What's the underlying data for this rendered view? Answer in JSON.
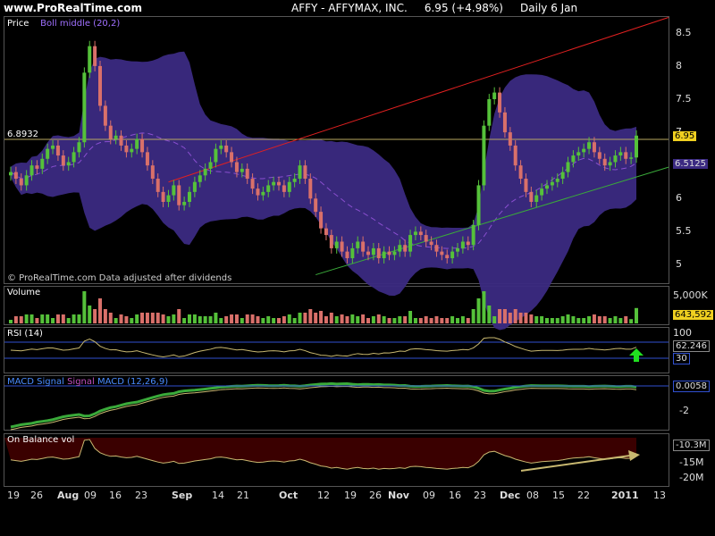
{
  "header": {
    "site": "www.ProRealTime.com",
    "ticker": "AFFY - AFFYMAX, INC.",
    "quote": "6.95 (+4.98%)",
    "period": "Daily  6 Jan"
  },
  "price_panel": {
    "label": "Price",
    "indicator": "Boll middle (20,2)",
    "watermark": "© ProRealTime.com  Data adjusted after dividends",
    "left_level": "6.8932",
    "last_price": "6.95",
    "boll_value": "6.5125",
    "ticks": [
      "8.5",
      "8",
      "7.5",
      "7",
      "6.5",
      "6",
      "5.5",
      "5"
    ]
  },
  "volume_panel": {
    "label": "Volume",
    "ticks": [
      "5,000K"
    ],
    "last": "643,592"
  },
  "rsi_panel": {
    "label": "RSI (14)",
    "ticks": [
      "100",
      "30"
    ],
    "last": "62.246"
  },
  "macd_panel": {
    "label_a": "MACD Signal",
    "label_b": "Signal",
    "label_c": "MACD (12,26,9)",
    "ticks": [
      "-2"
    ],
    "last": "0.0058"
  },
  "obv_panel": {
    "label": "On Balance vol",
    "ticks": [
      "-15M",
      "-20M"
    ],
    "last": "-10.3M"
  },
  "xaxis": {
    "labels": [
      "19",
      "26",
      "Aug",
      "09",
      "16",
      "23",
      "Sep",
      "14",
      "21",
      "Oct",
      "12",
      "19",
      "26",
      "Nov",
      "09",
      "16",
      "23",
      "Dec",
      "08",
      "15",
      "22",
      "2011",
      "13"
    ]
  },
  "colors": {
    "up": "#55c13a",
    "down": "#d9706a",
    "band": "#3b2a82",
    "resistance": "#e02020",
    "support": "#3aaa3a",
    "hline": "#b8a860",
    "obv_fill": "#3a0000"
  },
  "chart_data": [
    {
      "type": "candlestick",
      "title": "AFFY - AFFYMAX, INC.",
      "ylim": [
        4.75,
        8.7
      ],
      "x": [
        "Jul 19",
        "Jul 20",
        "Jul 21",
        "Jul 22",
        "Jul 23",
        "Jul 26",
        "Jul 27",
        "Jul 28",
        "Jul 29",
        "Jul 30",
        "Aug 02",
        "Aug 03",
        "Aug 04",
        "Aug 05",
        "Aug 06",
        "Aug 09",
        "Aug 10",
        "Aug 11",
        "Aug 12",
        "Aug 13",
        "Aug 16",
        "Aug 17",
        "Aug 18",
        "Aug 19",
        "Aug 20",
        "Aug 23",
        "Aug 24",
        "Aug 25",
        "Aug 26",
        "Aug 27",
        "Aug 30",
        "Aug 31",
        "Sep 01",
        "Sep 02",
        "Sep 03",
        "Sep 07",
        "Sep 08",
        "Sep 09",
        "Sep 10",
        "Sep 13",
        "Sep 14",
        "Sep 15",
        "Sep 16",
        "Sep 17",
        "Sep 20",
        "Sep 21",
        "Sep 22",
        "Sep 23",
        "Sep 24",
        "Sep 27",
        "Sep 28",
        "Sep 29",
        "Sep 30",
        "Oct 01",
        "Oct 04",
        "Oct 05",
        "Oct 06",
        "Oct 07",
        "Oct 08",
        "Oct 11",
        "Oct 12",
        "Oct 13",
        "Oct 14",
        "Oct 15",
        "Oct 18",
        "Oct 19",
        "Oct 20",
        "Oct 21",
        "Oct 22",
        "Oct 25",
        "Oct 26",
        "Oct 27",
        "Oct 28",
        "Oct 29",
        "Nov 01",
        "Nov 02",
        "Nov 03",
        "Nov 04",
        "Nov 05",
        "Nov 08",
        "Nov 09",
        "Nov 10",
        "Nov 11",
        "Nov 12",
        "Nov 15",
        "Nov 16",
        "Nov 17",
        "Nov 18",
        "Nov 19",
        "Nov 22",
        "Nov 23",
        "Nov 24",
        "Nov 26",
        "Nov 29",
        "Nov 30",
        "Dec 01",
        "Dec 02",
        "Dec 03",
        "Dec 06",
        "Dec 07",
        "Dec 08",
        "Dec 09",
        "Dec 10",
        "Dec 13",
        "Dec 14",
        "Dec 15",
        "Dec 16",
        "Dec 17",
        "Dec 20",
        "Dec 21",
        "Dec 22",
        "Dec 23",
        "Dec 27",
        "Dec 28",
        "Dec 29",
        "Dec 30",
        "Dec 31",
        "Jan 03",
        "Jan 04",
        "Jan 05",
        "Jan 06"
      ],
      "close": [
        6.4,
        6.3,
        6.2,
        6.35,
        6.5,
        6.45,
        6.6,
        6.75,
        6.8,
        6.65,
        6.5,
        6.55,
        6.7,
        6.85,
        7.9,
        8.3,
        8.0,
        7.4,
        7.1,
        6.9,
        6.95,
        6.8,
        6.7,
        6.75,
        6.9,
        6.7,
        6.5,
        6.3,
        6.1,
        5.95,
        6.05,
        6.2,
        5.9,
        5.95,
        6.1,
        6.25,
        6.35,
        6.45,
        6.55,
        6.75,
        6.8,
        6.7,
        6.55,
        6.4,
        6.45,
        6.3,
        6.15,
        6.05,
        6.1,
        6.2,
        6.25,
        6.2,
        6.1,
        6.25,
        6.3,
        6.5,
        6.3,
        6.0,
        5.8,
        5.55,
        5.45,
        5.25,
        5.35,
        5.2,
        5.1,
        5.25,
        5.35,
        5.2,
        5.15,
        5.25,
        5.1,
        5.2,
        5.15,
        5.2,
        5.3,
        5.2,
        5.45,
        5.5,
        5.45,
        5.35,
        5.3,
        5.2,
        5.15,
        5.1,
        5.2,
        5.25,
        5.35,
        5.3,
        5.6,
        6.2,
        7.1,
        7.5,
        7.6,
        7.3,
        7.0,
        6.8,
        6.5,
        6.3,
        6.1,
        5.95,
        6.05,
        6.15,
        6.2,
        6.25,
        6.3,
        6.4,
        6.55,
        6.65,
        6.7,
        6.75,
        6.85,
        6.7,
        6.6,
        6.5,
        6.55,
        6.65,
        6.7,
        6.6,
        6.62,
        6.95
      ],
      "support_line": [
        [
          "Oct 08",
          4.85
        ],
        [
          "Jan 06",
          6.35
        ]
      ],
      "resistance_line": [
        [
          "Aug 30",
          6.25
        ],
        [
          "Jan 06",
          8.6
        ]
      ],
      "hline": 6.8932
    }
  ]
}
